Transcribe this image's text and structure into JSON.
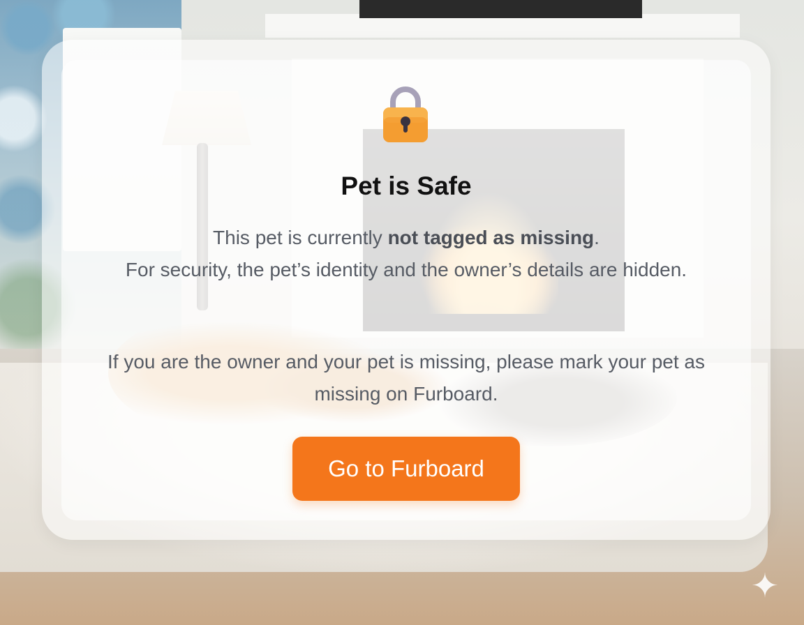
{
  "card": {
    "icon": "lock-icon",
    "title": "Pet is Safe",
    "line1_prefix": "This pet is currently ",
    "line1_bold": "not tagged as missing",
    "line1_suffix": ".",
    "line2": "For security, the pet’s identity and the owner’s details are hidden.",
    "line3": "If you are the owner and your pet is missing, please mark your pet as missing on Furboard.",
    "button_label": "Go to Furboard"
  },
  "colors": {
    "accent": "#f4761b",
    "lock_body": "#f6a43a",
    "lock_shackle": "#a7a1b8"
  },
  "corner_icon": "sparkle-icon"
}
